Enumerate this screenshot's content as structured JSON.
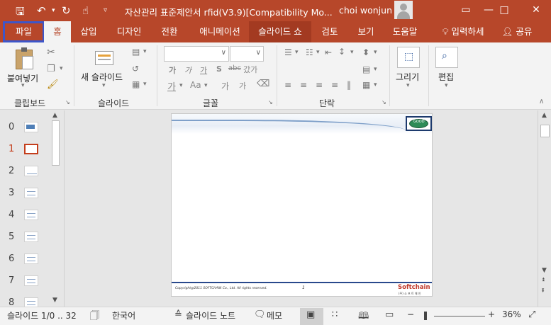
{
  "titlebar": {
    "title": "자산관리 표준제안서 rfid(V3.9)[Compatibility Mo...",
    "user": "choi wonjun",
    "icons": [
      "save-icon",
      "undo-icon",
      "redo-icon",
      "touch-mode-icon",
      "customize-icon"
    ],
    "window_buttons": [
      "ribbon-display-options-icon",
      "minimize-icon",
      "maximize-icon",
      "close-icon"
    ]
  },
  "tabs": [
    {
      "label": "파일"
    },
    {
      "label": "홈"
    },
    {
      "label": "삽입"
    },
    {
      "label": "디자인"
    },
    {
      "label": "전환"
    },
    {
      "label": "애니메이션"
    },
    {
      "label": "슬라이드 쇼"
    },
    {
      "label": "검토"
    },
    {
      "label": "보기"
    },
    {
      "label": "도움말"
    },
    {
      "label": "입력하세"
    },
    {
      "label": "공유"
    }
  ],
  "ribbon": {
    "clipboard": {
      "paste": "붙여넣기",
      "label": "클립보드"
    },
    "slides": {
      "new_slide": "새 슬라이드",
      "label": "슬라이드"
    },
    "font": {
      "label": "글꼴",
      "font_name": "",
      "font_size": "",
      "row2": [
        "가",
        "가",
        "가",
        "S",
        "abc",
        "갔가"
      ],
      "row3_a": "가",
      "row3_b": "Aa",
      "row3_c": "가",
      "row3_d": "가"
    },
    "paragraph": {
      "label": "단락"
    },
    "drawing": {
      "label": "그리기"
    },
    "editing": {
      "label": "편집"
    }
  },
  "thumbnails": [
    {
      "num": "0",
      "selected": false
    },
    {
      "num": "1",
      "selected": true
    },
    {
      "num": "2",
      "selected": false
    },
    {
      "num": "3",
      "selected": false
    },
    {
      "num": "4",
      "selected": false
    },
    {
      "num": "5",
      "selected": false
    },
    {
      "num": "6",
      "selected": false
    },
    {
      "num": "7",
      "selected": false
    },
    {
      "num": "8",
      "selected": false
    }
  ],
  "slide": {
    "logo_text": "GOOD",
    "copyright": "Copyright@2011 SOFTCHAIN Co., Ltd. All rights reserved.",
    "page_number": "1",
    "brand": "Softchain",
    "brand_sub": "(주) 소 프 트 체 인"
  },
  "status": {
    "slide_count": "슬라이드 1/0 .. 32",
    "language": "한국어",
    "notes": "슬라이드 노트",
    "comments": "메모",
    "zoom": "36%"
  }
}
